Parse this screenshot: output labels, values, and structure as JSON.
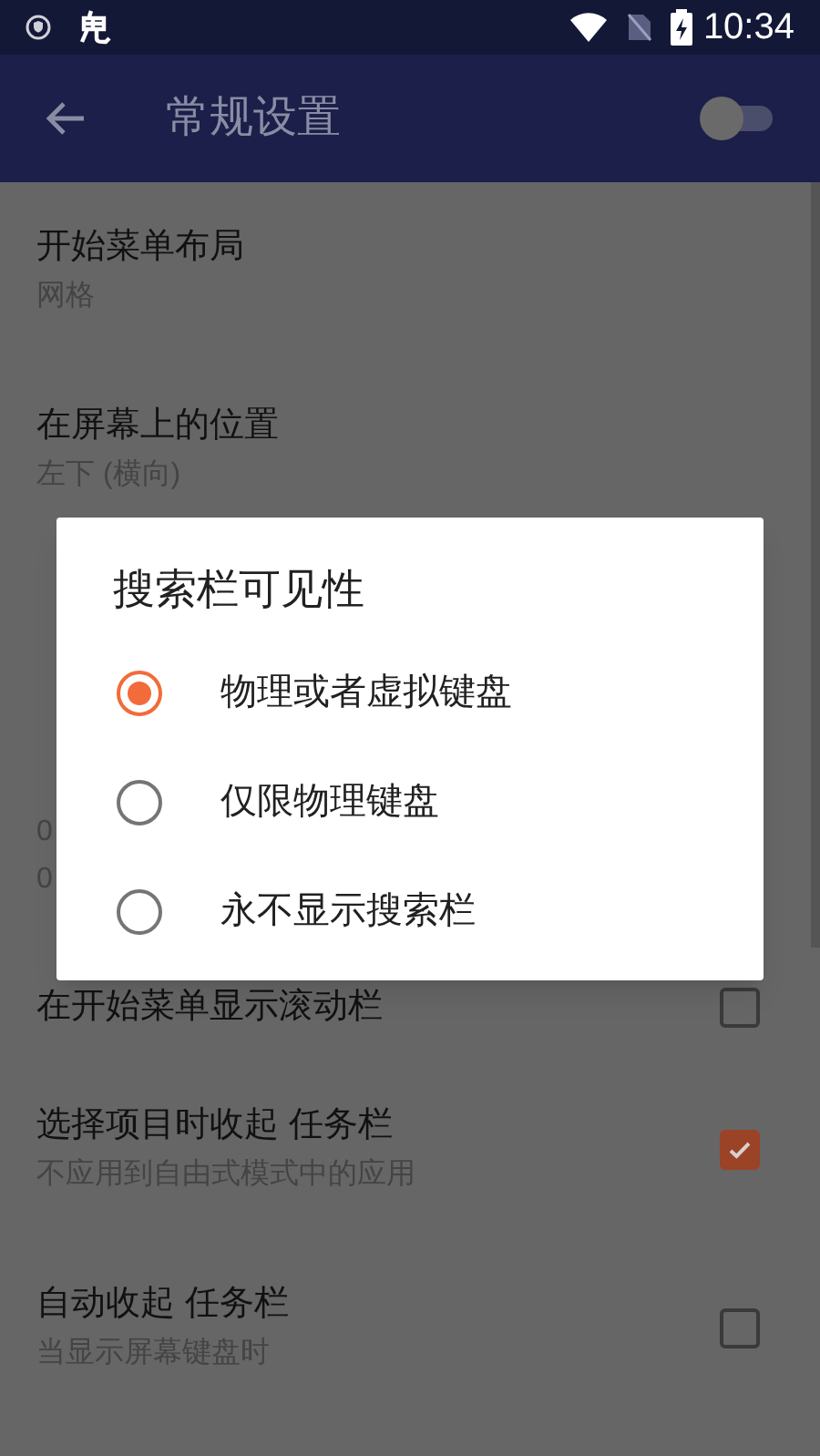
{
  "status_bar": {
    "time": "10:34"
  },
  "app_bar": {
    "title": "常规设置",
    "switch_on": false
  },
  "settings": [
    {
      "kind": "text",
      "title": "开始菜单布局",
      "lines": [
        "网格"
      ]
    },
    {
      "kind": "text",
      "title": "在屏幕上的位置",
      "lines": [
        "左下 (横向)"
      ]
    },
    {
      "kind": "text",
      "lines": [
        "0",
        "0"
      ]
    },
    {
      "kind": "checkbox",
      "title": "在开始菜单显示滚动栏",
      "checked": false
    },
    {
      "kind": "checkbox",
      "title": "选择项目时收起 任务栏",
      "lines": [
        "不应用到自由式模式中的应用"
      ],
      "checked": true
    },
    {
      "kind": "checkbox",
      "title": "自动收起 任务栏",
      "lines": [
        "当显示屏幕键盘时"
      ],
      "checked": false
    }
  ],
  "dialog": {
    "title": "搜索栏可见性",
    "options": [
      {
        "label": "物理或者虚拟键盘",
        "selected": true
      },
      {
        "label": "仅限物理键盘",
        "selected": false
      },
      {
        "label": "永不显示搜索栏",
        "selected": false
      }
    ]
  }
}
